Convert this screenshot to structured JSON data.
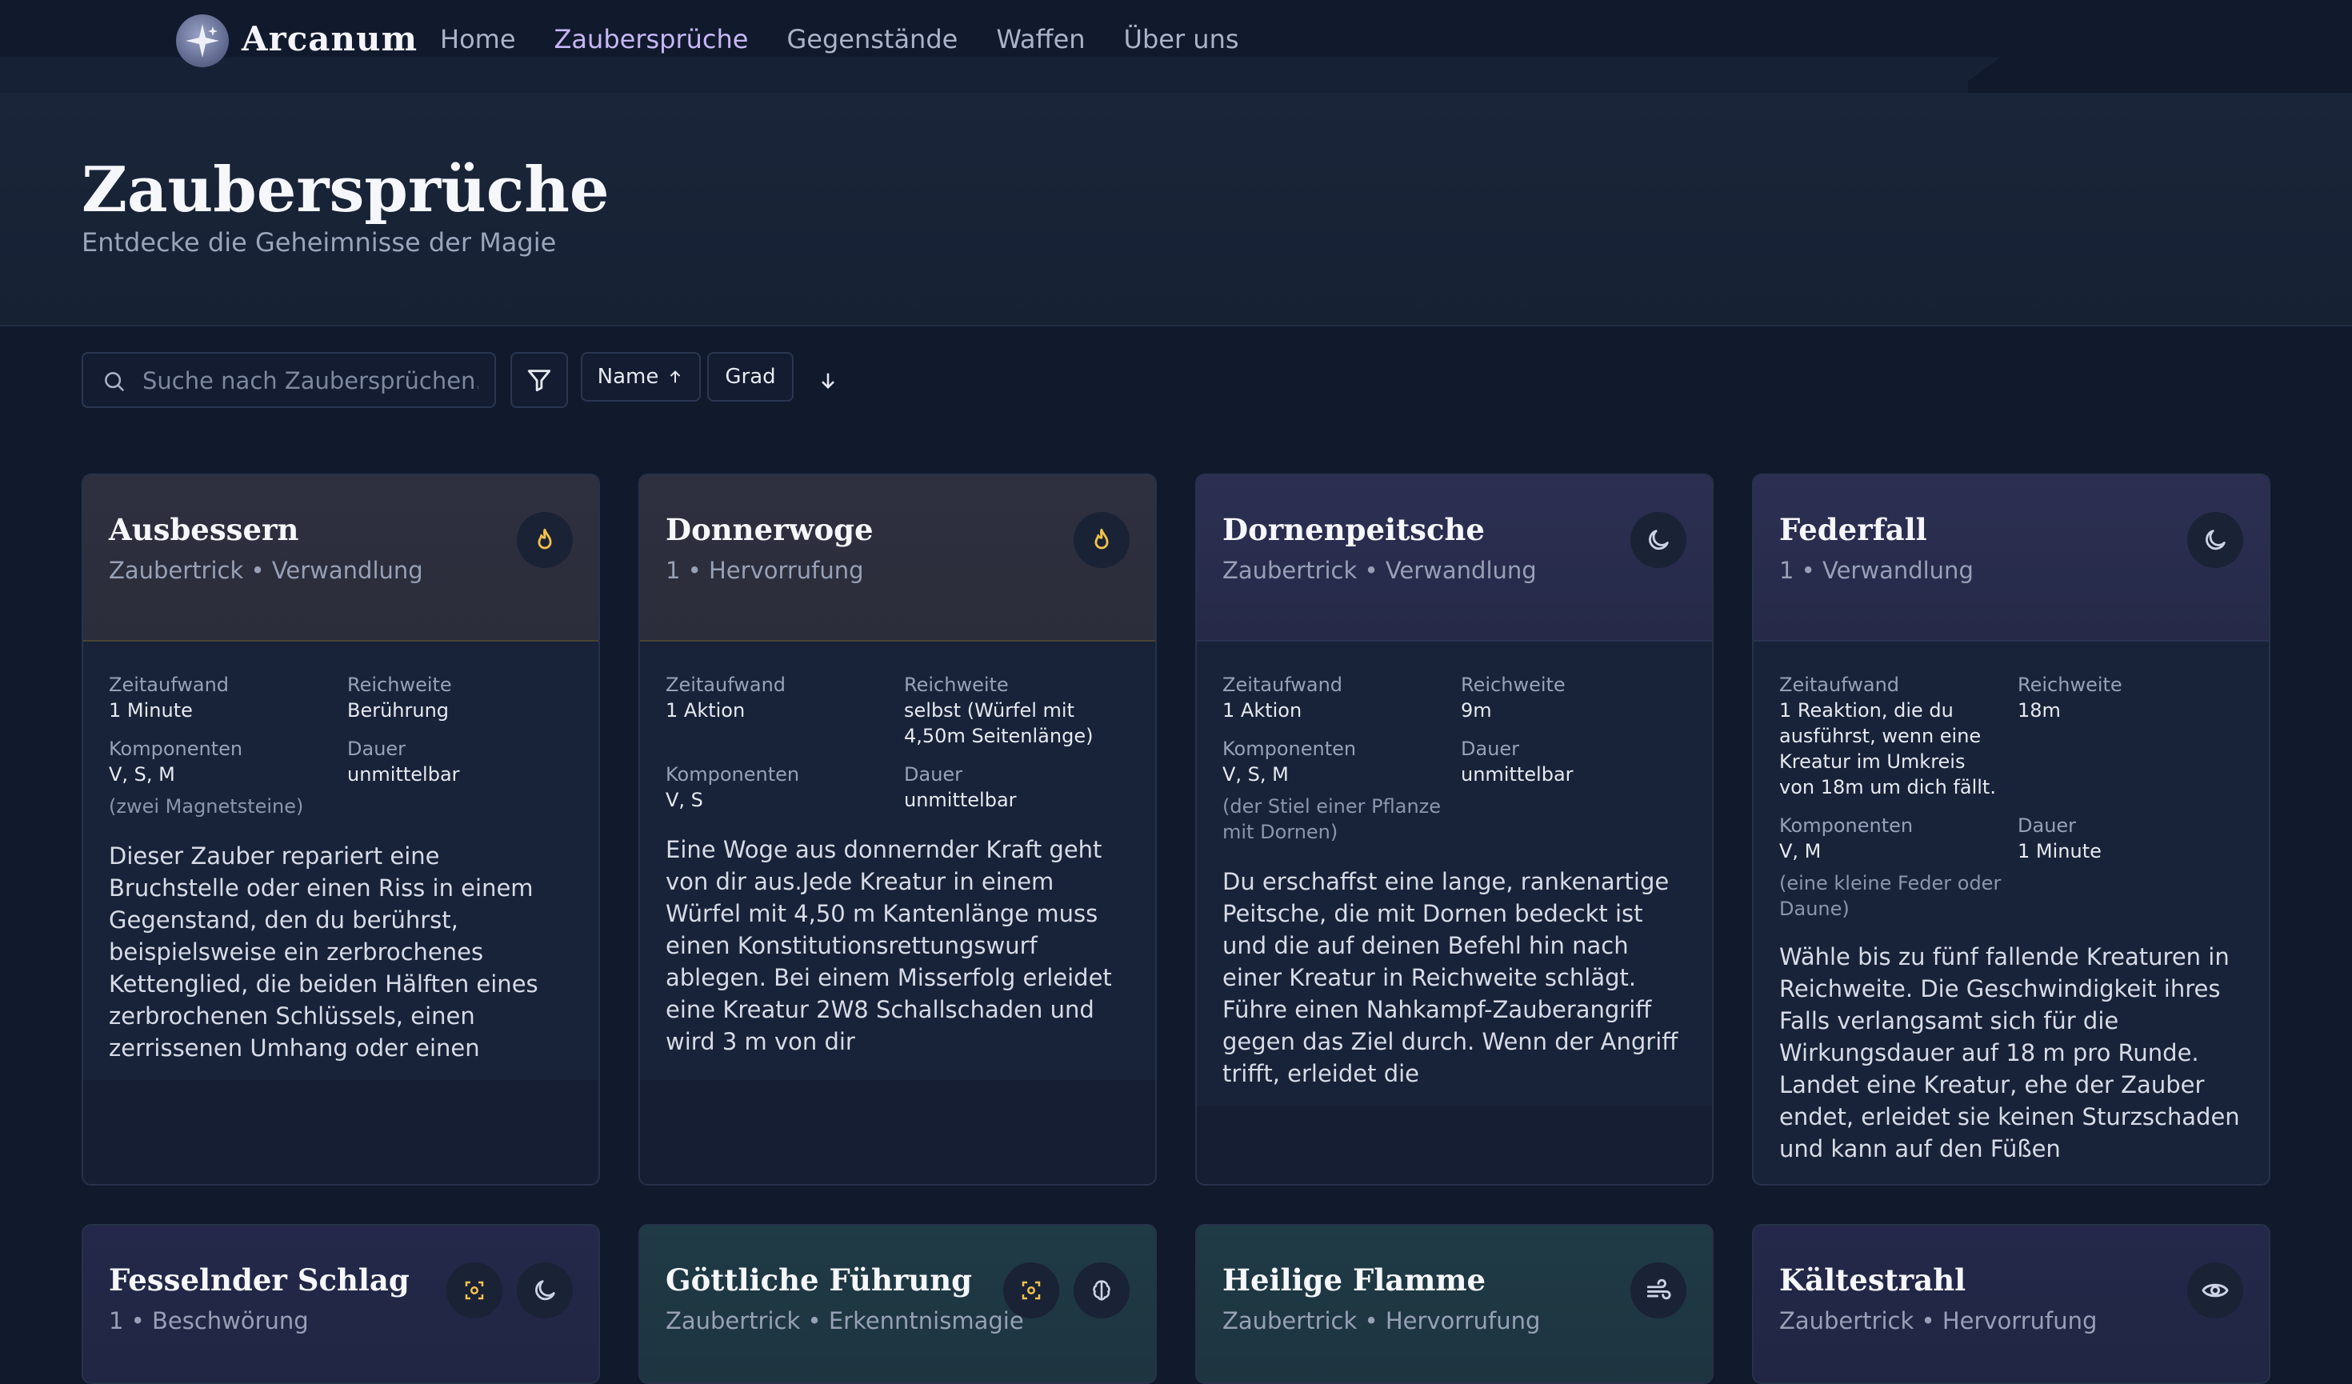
{
  "brand": "Arcanum",
  "nav": [
    {
      "label": "Home",
      "active": false
    },
    {
      "label": "Zaubersprüche",
      "active": true
    },
    {
      "label": "Gegenstände",
      "active": false
    },
    {
      "label": "Waffen",
      "active": false
    },
    {
      "label": "Über uns",
      "active": false
    }
  ],
  "hero": {
    "title": "Zaubersprüche",
    "subtitle": "Entdecke die Geheimnisse der Magie"
  },
  "toolbar": {
    "search_placeholder": "Suche nach Zaubersprüchen...",
    "sort_name": "Name",
    "sort_grad": "Grad"
  },
  "labels": {
    "time": "Zeitaufwand",
    "range": "Reichweite",
    "components": "Komponenten",
    "duration": "Dauer"
  },
  "colors": {
    "accent": "#c7b6f5",
    "fire": "#f3c24b",
    "moon": "#cdd3e6"
  },
  "cards": [
    {
      "title": "Ausbessern",
      "meta": "Zaubertrick • Verwandlung",
      "icon": "flame-icon",
      "time": "1 Minute",
      "range": "Berührung",
      "components": "V, S, M",
      "duration": "unmittelbar",
      "note": "(zwei Magnetsteine)",
      "description": "Dieser Zauber repariert eine Bruchstelle oder einen Riss in einem Gegenstand, den du berührst, beispielsweise ein zerbrochenes Kettenglied, die beiden Hälften eines zerbrochenen Schlüssels, einen zerrissenen Umhang oder einen"
    },
    {
      "title": "Donnerwoge",
      "meta": "1 • Hervorrufung",
      "icon": "flame-icon",
      "time": "1 Aktion",
      "range": "selbst (Würfel mit 4,50m Seitenlänge)",
      "components": "V, S",
      "duration": "unmittelbar",
      "note": "",
      "description": "Eine Woge aus donnernder Kraft geht von dir aus.Jede Kreatur in einem Würfel mit 4,50 m Kantenlänge muss einen Konstitutionsrettungswurf ablegen. Bei einem Misserfolg erleidet eine Kreatur 2W8 Schallschaden und wird 3 m von dir"
    },
    {
      "title": "Dornenpeitsche",
      "meta": "Zaubertrick • Verwandlung",
      "icon": "moon-icon",
      "time": "1 Aktion",
      "range": "9m",
      "components": "V, S, M",
      "duration": "unmittelbar",
      "note": "(der Stiel einer Pflanze mit Dornen)",
      "description": "Du erschaffst eine lange, rankenartige Peitsche, die mit Dornen bedeckt ist und die auf deinen Befehl hin nach einer Kreatur in Reichweite schlägt. Führe einen Nahkampf-Zauberangriff gegen das Ziel durch. Wenn der Angriff trifft, erleidet die"
    },
    {
      "title": "Federfall",
      "meta": "1 • Verwandlung",
      "icon": "moon-icon",
      "time": "1 Reaktion, die du ausführst, wenn eine Kreatur im Umkreis von 18m um dich fällt.",
      "range": "18m",
      "components": "V, M",
      "duration": "1 Minute",
      "note": "(eine kleine Feder oder Daune)",
      "description": "Wähle bis zu fünf fallende Kreaturen in Reichweite. Die Geschwindigkeit ihres Falls verlangsamt sich für die Wirkungsdauer auf 18 m pro Runde. Landet eine Kreatur, ehe der Zauber endet, erleidet sie keinen Sturzschaden und kann auf den Füßen"
    }
  ],
  "cards_row2": [
    {
      "title": "Fesselnder Schlag",
      "meta": "1 • Beschwörung"
    },
    {
      "title": "Göttliche Führung",
      "meta": "Zaubertrick • Erkenntnismagie"
    },
    {
      "title": "Heilige Flamme",
      "meta": "Zaubertrick • Hervorrufung"
    },
    {
      "title": "Kältestrahl",
      "meta": "Zaubertrick • Hervorrufung"
    }
  ]
}
